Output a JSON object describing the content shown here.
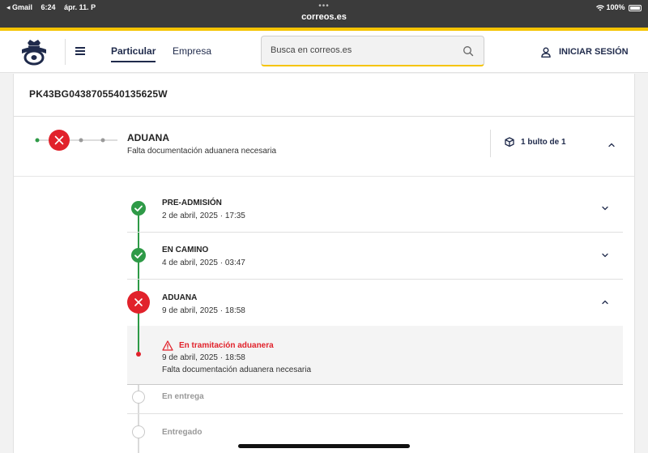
{
  "statusbar": {
    "carrier": "◂ Gmail",
    "time": "6:24",
    "date": "ápr. 11. P",
    "dots": "•••",
    "url": "correos.es",
    "battery": "100%"
  },
  "header": {
    "nav": {
      "tab1": "Particular",
      "tab2": "Empresa"
    },
    "search": {
      "placeholder": "Busca en correos.es"
    },
    "login_label": "INICIAR SESIÓN"
  },
  "shipment": {
    "tracking_number": "PK43BG0438705540135625W",
    "summary": {
      "status": "ADUANA",
      "description": "Falta documentación aduanera necesaria",
      "packages": "1 bulto de 1"
    },
    "timeline": {
      "step1": {
        "title": "PRE-ADMISIÓN",
        "date": "2 de abril, 2025 · 17:35",
        "state": "done"
      },
      "step2": {
        "title": "EN CAMINO",
        "date": "4 de abril, 2025 · 03:47",
        "state": "done"
      },
      "step3": {
        "title": "ADUANA",
        "date": "9 de abril, 2025 · 18:58",
        "state": "error"
      },
      "detail": {
        "title": "En tramitación aduanera",
        "date": "9 de abril, 2025 · 18:58",
        "description": "Falta documentación aduanera necesaria"
      },
      "step4": {
        "title": "En entrega",
        "state": "pending"
      },
      "step5": {
        "title": "Entregado",
        "state": "pending"
      }
    }
  },
  "colors": {
    "brand_yellow": "#f5c400",
    "brand_navy": "#1f2a4b",
    "success": "#2e9a47",
    "error": "#e1222b"
  }
}
